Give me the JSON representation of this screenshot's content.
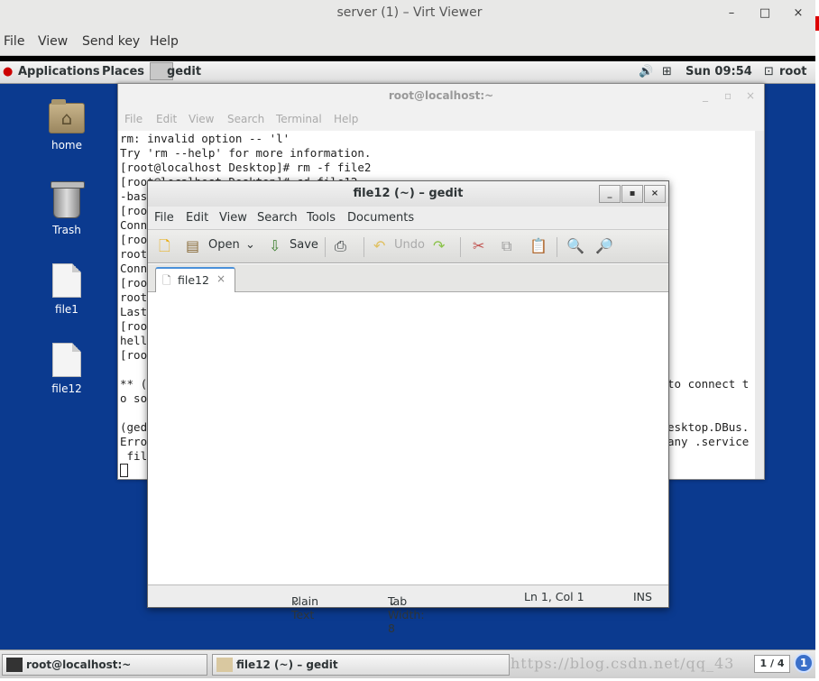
{
  "viewer": {
    "title": "server (1) – Virt Viewer",
    "controls": {
      "minimize": "–",
      "maximize": "□",
      "close": "×"
    },
    "menu": [
      "File",
      "View",
      "Send key",
      "Help"
    ]
  },
  "gnome_panel": {
    "applications": "Applications",
    "places": "Places",
    "active_app": "gedit",
    "clock": "Sun 09:54",
    "user": "root"
  },
  "desktop_icons": [
    {
      "label": "home",
      "icon": "home-folder-icon"
    },
    {
      "label": "Trash",
      "icon": "trash-icon"
    },
    {
      "label": "file1",
      "icon": "file-icon"
    },
    {
      "label": "file12",
      "icon": "file-icon"
    }
  ],
  "terminal": {
    "title": "root@localhost:~",
    "menu": [
      "File",
      "Edit",
      "View",
      "Search",
      "Terminal",
      "Help"
    ],
    "lines": [
      "rm: invalid option -- 'l'",
      "Try 'rm --help' for more information.",
      "[root@localhost Desktop]# rm -f file2",
      "[root@localhost Desktop]# cd file12",
      "-bas",
      "[roo",
      "Conn",
      "[roo",
      "root",
      "Conn",
      "[roo",
      "root",
      "Last",
      "[roo",
      "hell",
      "[roo",
      "",
      "** (",
      "o so",
      "",
      "(ged",
      "Erro",
      " fil"
    ],
    "right_fragments": [
      {
        "line": 17,
        "text": "to connect t"
      },
      {
        "line": 20,
        "text": "esktop.DBus."
      },
      {
        "line": 21,
        "text": "any .service"
      }
    ]
  },
  "gedit": {
    "title": "file12 (~) – gedit",
    "menu": [
      "File",
      "Edit",
      "View",
      "Search",
      "Tools",
      "Documents"
    ],
    "toolbar": {
      "open": "Open",
      "save": "Save",
      "undo": "Undo"
    },
    "tab": {
      "label": "file12",
      "close": "×"
    },
    "content": "",
    "status": {
      "language": "Plain Text",
      "tab_width": "Tab Width:  8",
      "position": "Ln 1, Col 1",
      "mode": "INS"
    }
  },
  "taskbar": {
    "tasks": [
      {
        "label": "root@localhost:~"
      },
      {
        "label": "file12 (~) – gedit"
      }
    ],
    "watermark": "https://blog.csdn.net/qq_43",
    "pager": "1 / 4",
    "notification": "1"
  }
}
